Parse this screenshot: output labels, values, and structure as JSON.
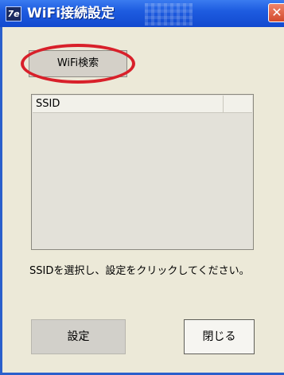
{
  "window": {
    "title": "WiFi接続設定",
    "app_icon_text": "7e",
    "close_glyph": "✕"
  },
  "toolbar": {
    "search_label": "WiFi検索"
  },
  "list": {
    "columns": [
      "SSID",
      ""
    ],
    "rows": []
  },
  "instruction": "SSIDを選択し、設定をクリックしてください。",
  "buttons": {
    "settings_label": "設定",
    "close_label": "閉じる"
  },
  "colors": {
    "titlebar": "#1e5ce0",
    "highlight": "#d8202a",
    "window_bg": "#ece9d8"
  }
}
